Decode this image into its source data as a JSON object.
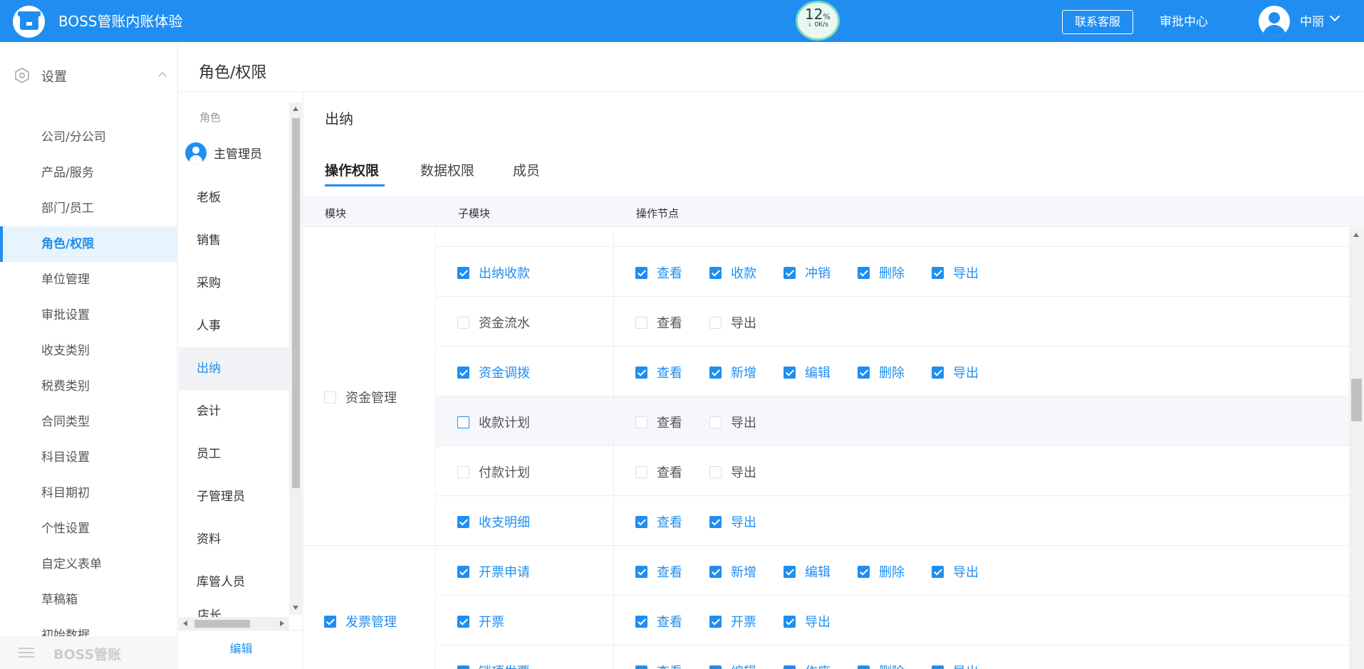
{
  "header": {
    "app_title": "BOSS管账内账体验",
    "speed_percent": "12",
    "speed_unit": "%",
    "speed_rate": "0K/s",
    "contact_label": "联系客服",
    "approval_label": "审批中心",
    "user_name": "中丽"
  },
  "sidebar": {
    "group_label": "设置",
    "items": [
      {
        "label": "公司/分公司"
      },
      {
        "label": "产品/服务"
      },
      {
        "label": "部门/员工"
      },
      {
        "label": "角色/权限"
      },
      {
        "label": "单位管理"
      },
      {
        "label": "审批设置"
      },
      {
        "label": "收支类别"
      },
      {
        "label": "税费类别"
      },
      {
        "label": "合同类型"
      },
      {
        "label": "科目设置"
      },
      {
        "label": "科目期初"
      },
      {
        "label": "个性设置"
      },
      {
        "label": "自定义表单"
      },
      {
        "label": "草稿箱"
      },
      {
        "label": "初始数据"
      }
    ],
    "active_item": "角色/权限",
    "footer_label": "BOSS管账"
  },
  "page": {
    "title": "角色/权限"
  },
  "roles": {
    "header": "角色",
    "root": "主管理员",
    "items": [
      {
        "label": "老板"
      },
      {
        "label": "销售"
      },
      {
        "label": "采购"
      },
      {
        "label": "人事"
      },
      {
        "label": "出纳"
      },
      {
        "label": "会计"
      },
      {
        "label": "员工"
      },
      {
        "label": "子管理员"
      },
      {
        "label": "资料"
      },
      {
        "label": "库管人员"
      }
    ],
    "partial_item": "店长",
    "active": "出纳",
    "edit_label": "编辑"
  },
  "detail": {
    "title": "出纳",
    "tabs": [
      {
        "label": "操作权限"
      },
      {
        "label": "数据权限"
      },
      {
        "label": "成员"
      }
    ],
    "active_tab": "操作权限",
    "columns": {
      "module": "模块",
      "submodule": "子模块",
      "ops": "操作节点"
    },
    "modules": [
      {
        "name": "资金管理",
        "checked": false,
        "rows": [
          {
            "name": "出纳收款",
            "checked": true,
            "ops": [
              {
                "label": "查看",
                "checked": true
              },
              {
                "label": "收款",
                "checked": true
              },
              {
                "label": "冲销",
                "checked": true
              },
              {
                "label": "删除",
                "checked": true
              },
              {
                "label": "导出",
                "checked": true
              }
            ]
          },
          {
            "name": "资金流水",
            "checked": false,
            "ops": [
              {
                "label": "查看",
                "checked": false
              },
              {
                "label": "导出",
                "checked": false
              }
            ]
          },
          {
            "name": "资金调拨",
            "checked": true,
            "ops": [
              {
                "label": "查看",
                "checked": true
              },
              {
                "label": "新增",
                "checked": true
              },
              {
                "label": "编辑",
                "checked": true
              },
              {
                "label": "删除",
                "checked": true
              },
              {
                "label": "导出",
                "checked": true
              }
            ]
          },
          {
            "name": "收款计划",
            "checked": false,
            "ops": [
              {
                "label": "查看",
                "checked": false
              },
              {
                "label": "导出",
                "checked": false
              }
            ]
          },
          {
            "name": "付款计划",
            "checked": false,
            "ops": [
              {
                "label": "查看",
                "checked": false
              },
              {
                "label": "导出",
                "checked": false
              }
            ]
          },
          {
            "name": "收支明细",
            "checked": true,
            "ops": [
              {
                "label": "查看",
                "checked": true
              },
              {
                "label": "导出",
                "checked": true
              }
            ]
          }
        ]
      },
      {
        "name": "发票管理",
        "checked": true,
        "rows": [
          {
            "name": "开票申请",
            "checked": true,
            "ops": [
              {
                "label": "查看",
                "checked": true
              },
              {
                "label": "新增",
                "checked": true
              },
              {
                "label": "编辑",
                "checked": true
              },
              {
                "label": "删除",
                "checked": true
              },
              {
                "label": "导出",
                "checked": true
              }
            ]
          },
          {
            "name": "开票",
            "checked": true,
            "ops": [
              {
                "label": "查看",
                "checked": true
              },
              {
                "label": "开票",
                "checked": true
              },
              {
                "label": "导出",
                "checked": true
              }
            ]
          },
          {
            "name": "销项发票",
            "checked": true,
            "ops": [
              {
                "label": "查看",
                "checked": true
              },
              {
                "label": "编辑",
                "checked": true
              },
              {
                "label": "作废",
                "checked": true
              },
              {
                "label": "删除",
                "checked": true
              },
              {
                "label": "导出",
                "checked": true
              }
            ]
          }
        ]
      }
    ]
  },
  "colors": {
    "primary": "#1f8ef0",
    "active_bg": "#e7f3fd",
    "header_bg": "#f5f7fa"
  }
}
